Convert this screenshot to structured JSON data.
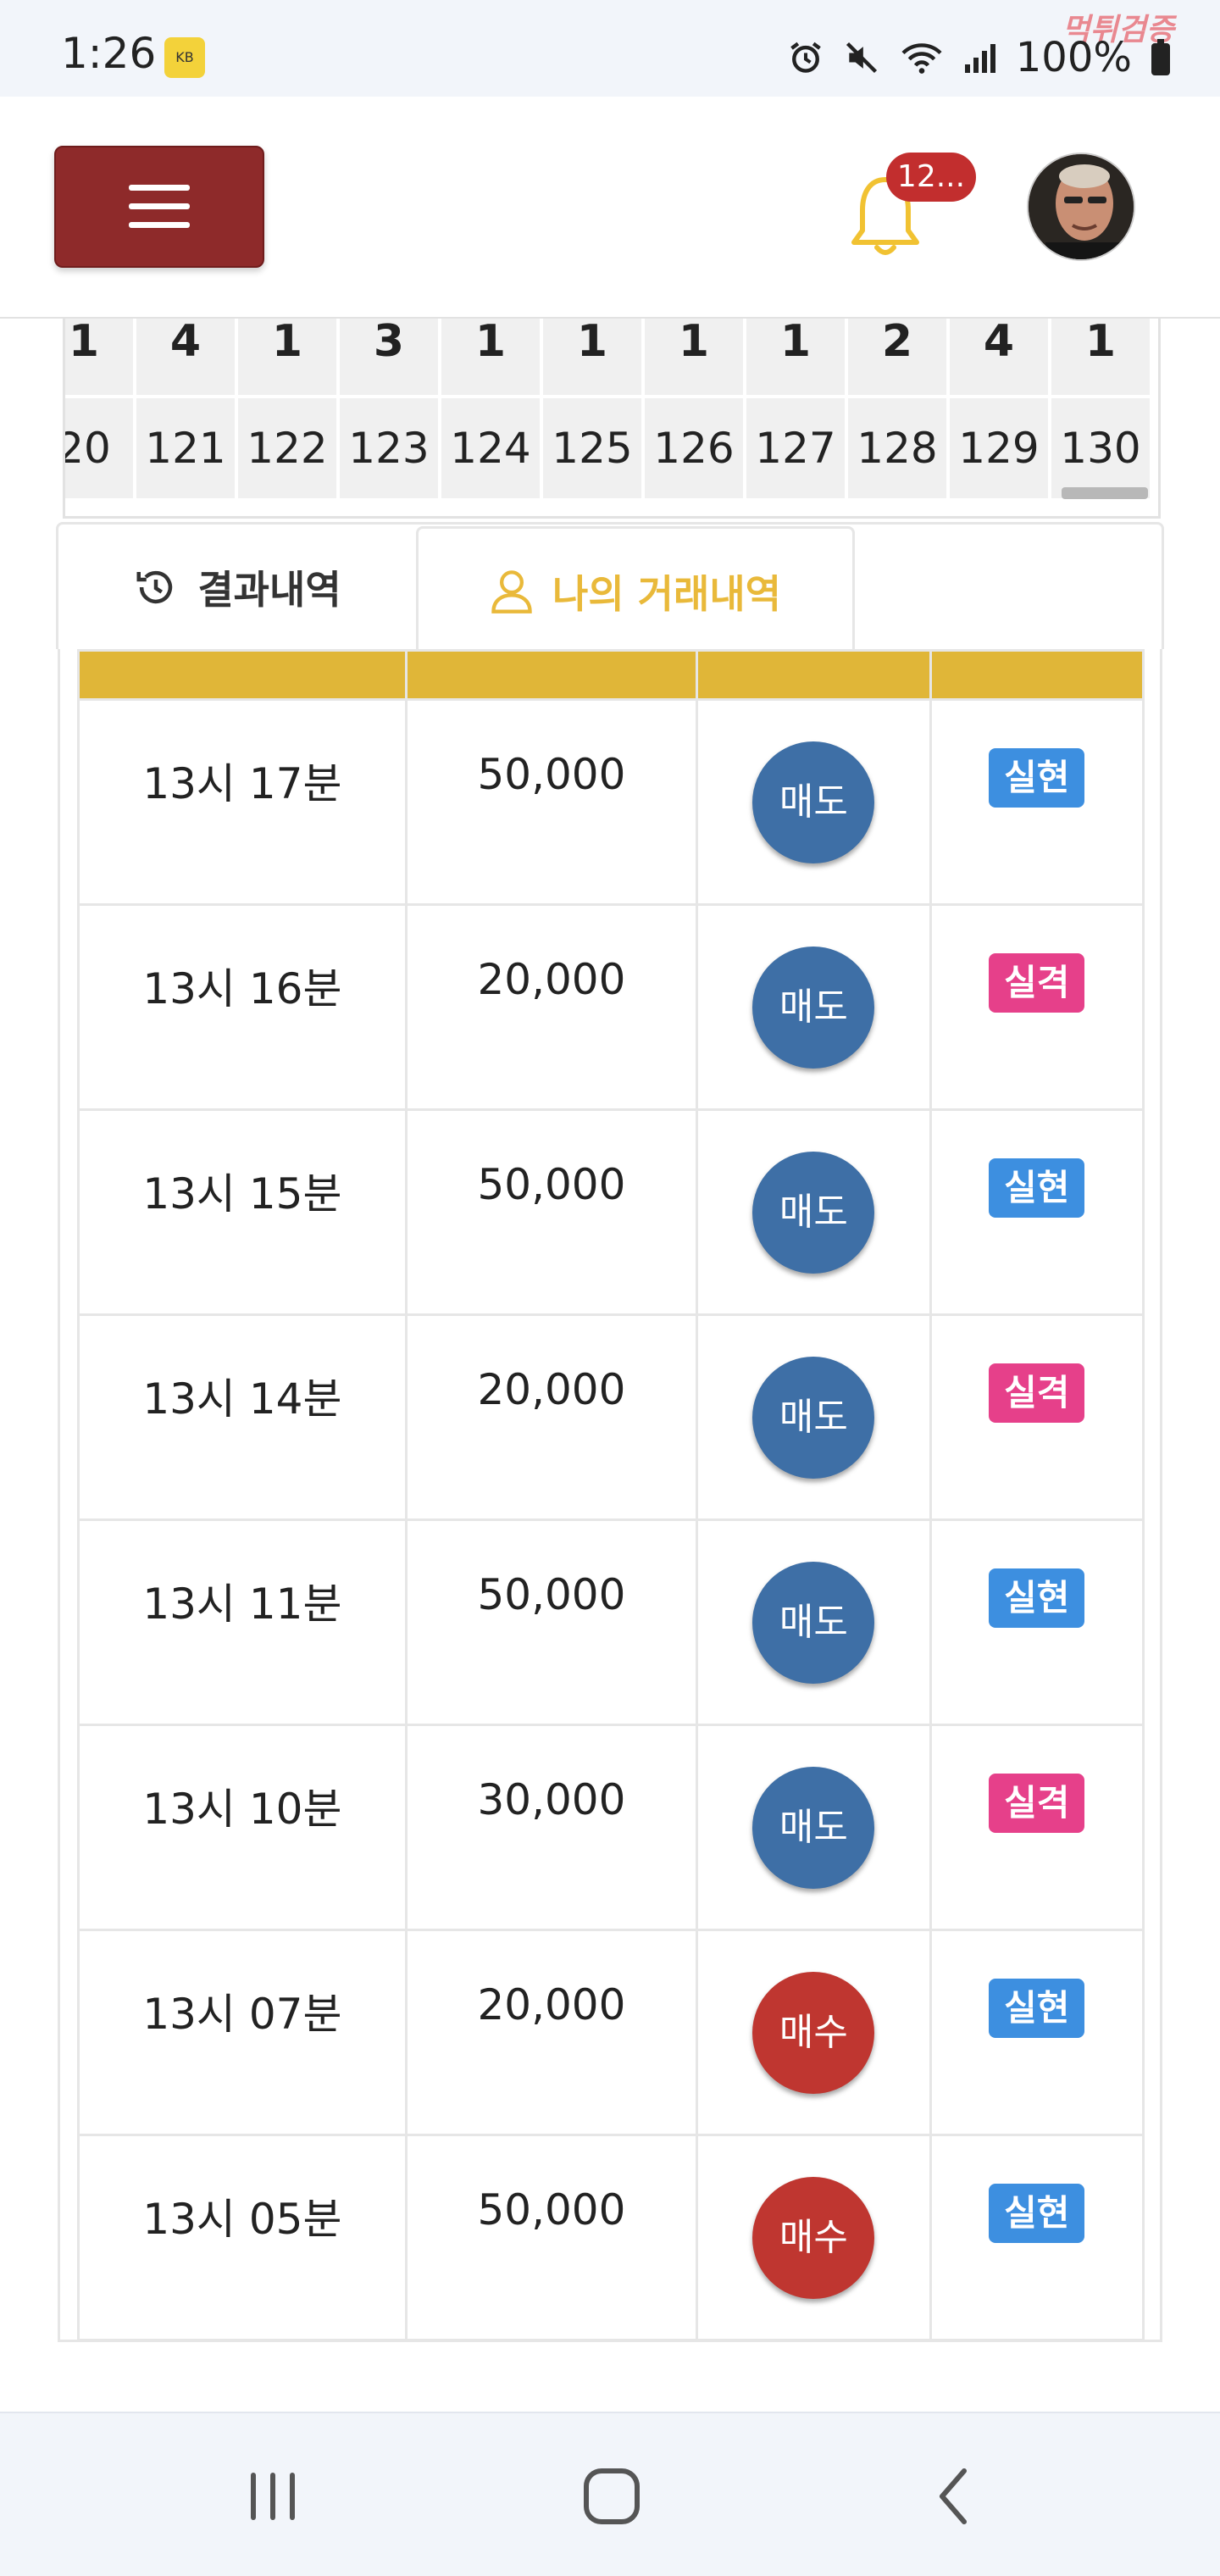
{
  "status_bar": {
    "time": "1:26",
    "app_icon_label": "KB",
    "battery": "100%",
    "watermark": "먹튀검증"
  },
  "header": {
    "notification_count": "12...",
    "colors": {
      "menu_button": "#8e2a2a",
      "bell": "#f1c232",
      "badge": "#c22e2e"
    }
  },
  "round_grid": {
    "columns": [
      {
        "count": "1",
        "round": "20"
      },
      {
        "count": "4",
        "round": "121"
      },
      {
        "count": "1",
        "round": "122"
      },
      {
        "count": "3",
        "round": "123"
      },
      {
        "count": "1",
        "round": "124"
      },
      {
        "count": "1",
        "round": "125"
      },
      {
        "count": "1",
        "round": "126"
      },
      {
        "count": "1",
        "round": "127"
      },
      {
        "count": "2",
        "round": "128"
      },
      {
        "count": "4",
        "round": "129"
      },
      {
        "count": "1",
        "round": "130"
      }
    ]
  },
  "tabs": {
    "results_label": "결과내역",
    "my_trades_label": "나의 거래내역",
    "active": "my_trades"
  },
  "trades": {
    "header_color": "#e0b638",
    "rows": [
      {
        "time": "13시 17분",
        "amount": "50,000",
        "side": "매도",
        "side_type": "sell",
        "result": "실현",
        "result_type": "win"
      },
      {
        "time": "13시 16분",
        "amount": "20,000",
        "side": "매도",
        "side_type": "sell",
        "result": "실격",
        "result_type": "lose"
      },
      {
        "time": "13시 15분",
        "amount": "50,000",
        "side": "매도",
        "side_type": "sell",
        "result": "실현",
        "result_type": "win"
      },
      {
        "time": "13시 14분",
        "amount": "20,000",
        "side": "매도",
        "side_type": "sell",
        "result": "실격",
        "result_type": "lose"
      },
      {
        "time": "13시 11분",
        "amount": "50,000",
        "side": "매도",
        "side_type": "sell",
        "result": "실현",
        "result_type": "win"
      },
      {
        "time": "13시 10분",
        "amount": "30,000",
        "side": "매도",
        "side_type": "sell",
        "result": "실격",
        "result_type": "lose"
      },
      {
        "time": "13시 07분",
        "amount": "20,000",
        "side": "매수",
        "side_type": "buy",
        "result": "실현",
        "result_type": "win"
      },
      {
        "time": "13시 05분",
        "amount": "50,000",
        "side": "매수",
        "side_type": "buy",
        "result": "실현",
        "result_type": "win"
      }
    ],
    "colors": {
      "sell": "#3e6fa6",
      "buy": "#bf3630",
      "win": "#3d8fe0",
      "lose": "#e6408a"
    }
  },
  "nav_bar": {
    "icons": [
      "recent-apps-icon",
      "home-icon",
      "back-icon"
    ]
  }
}
